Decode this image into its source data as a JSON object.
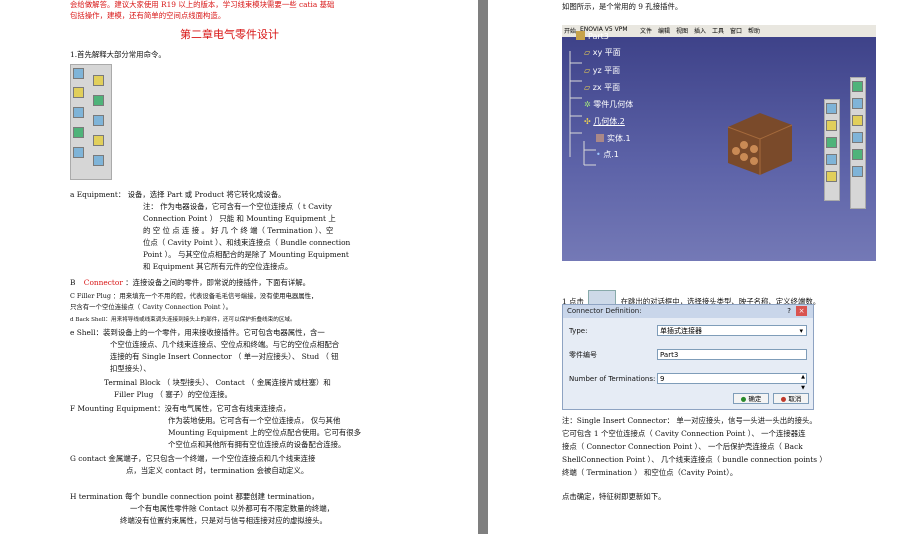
{
  "left_page": {
    "intro_fragment": "会给做解答。建议大家使用 R19 以上的版本，学习线束模块需要一些 catia 基础",
    "intro_fragment2": "包括操作，建模，还有简单的空间点线面构造。",
    "chapter_title": "第二章电气零件设计",
    "item1": "1.首先解释大部分常用命令。",
    "a_equipment": "a Equipment： 设备，选择 Part 或 Product 将它转化成设备。",
    "note_1": "注： 作为电器设备，它可含有一个空位连接点（ t Cavity",
    "note_2": "Connection Point ） 只能 和 Mounting Equipment 上",
    "note_3": "的 空 位 点 连 接 。 好 几 个 终 端（ Termination ）、空",
    "note_4": "位点（ Cavity Point ）、和线束连接点（ Bundle connection",
    "note_5": "Point ）。 与其空位点相配合的是除了 Mounting Equipment",
    "note_6": "和 Equipment 其它所有元件的空位连接点。",
    "b_label": "B",
    "b_connector": "Connector",
    "b_text": "：连接设备之间的零件，即常说的接插件，下面有详解。",
    "c_line1": "C Filler Plug ：用来填充一个不用的腔，代表设备毛毛信号端接，没有使用电器属性，",
    "c_line2": "只含有一个空位连接点（ Cavity Connection Point ）。",
    "d_line": "d Back Shell：用来将导线或线束调头连接到接头上的部件，还可以保护折叠线束的区域。",
    "e_line1": "e Shell：装到设备上的一个零件，用来接收接插件。它可包含电器属性，含一",
    "e_line2": "个空位连接点、几个线束连接点、空位点和终端。与它的空位点相配合",
    "e_line3": "连接的有 Single Insert Connector （ 单一对应接头）、 Stud （ 钮",
    "e_line4": "扣型接头）、",
    "e_line5": "Terminal Block （ 块型接头）、 Contact （ 金属连接片或柱塞）和",
    "e_line6": "Filler Plug （ 塞子）的空位连接。",
    "f_line1": "F Mounting Equipment：没有电气属性，它可含有线束连接点，",
    "f_line2": "作为装地使用。它可含有一个空位连接点， 仅与其他",
    "f_line3": "Mounting Equipment 上的空位点配合使用。它可有很多",
    "f_line4": "个空位点和其他所有拥有空位连接点的设备配合连接。",
    "g_line1": "G contact 金属端子，它只包含一个终端，一个空位连接点和几个线束连接",
    "g_line2": "点，当定义 contact 时，termination 会被自动定义。",
    "h_line1": "H termination 每个 bundle connection point 都要创建 termination，",
    "h_line2": "一个有电属性零件除 Contact 以外都可有不限定数量的终端，",
    "h_line3": "终端没有位置约束属性，只是对与信号相连接对应的虚拟接头。"
  },
  "right_page": {
    "caption_top": "如图所示，是个常用的 9 孔接插件。",
    "catia_menu": [
      "开始",
      "ENOVIA V5 VPM",
      "文件",
      "编辑",
      "视图",
      "插入",
      "工具",
      "窗口",
      "帮助"
    ],
    "tree": {
      "root": "Part3",
      "xy": "xy 平面",
      "yz": "yz 平面",
      "zx": "zx 平面",
      "geo": "零件几何体",
      "body": "几何体.2",
      "solid": "实体.1",
      "point": "点.1"
    },
    "step1_prefix": "1 点击",
    "step1_suffix": "在跳出的对话框中，选择接头类型、映子名称、定义终端数。",
    "dialog": {
      "title": "Connector Definition:",
      "type_label": "Type:",
      "type_value": "单插式连接器",
      "partno_label": "零件编号",
      "partno_value": "Part3",
      "terms_label": "Number of Terminations:",
      "terms_value": "9",
      "ok_label": "确定",
      "cancel_label": "取消"
    },
    "note_1": "注：Single Insert Connector： 单一对应接头，信号一头进一头出的接头。",
    "note_2": "它可包含 1 个空位连接点（ Cavity Connection Point ）、 一个连接器连",
    "note_3": "接点（ Connector Connection Point ）、 一个后保护壳连接点（ Back",
    "note_4": "ShellConnection Point ）、 几个线束连接点（ bundle connection points ）",
    "note_5": "终端（ Termination ） 和空位点（Cavity Point）。",
    "step2": "点击确定，特征树即更新如下。"
  }
}
